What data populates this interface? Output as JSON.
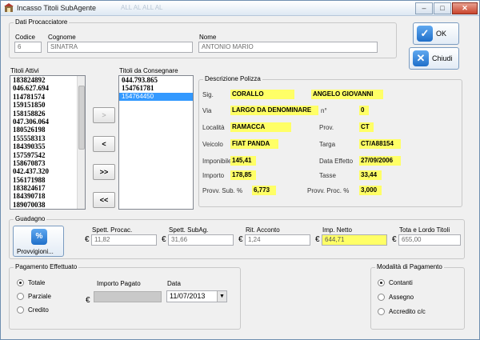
{
  "window": {
    "title": "Incasso Titoli SubAgente",
    "ghost_text": "ALL AL    ALL AL",
    "min_label": "–",
    "max_label": "□",
    "close_label": "✕"
  },
  "dati_procacciatore": {
    "group_label": "Dati Procacciatore",
    "codice_label": "Codice",
    "codice_value": "6",
    "cognome_label": "Cognome",
    "cognome_value": "SINATRA",
    "nome_label": "Nome",
    "nome_value": "ANTONIO MARIO"
  },
  "buttons": {
    "ok_label": "OK",
    "chiudi_label": "Chiudi",
    "move_right": ">",
    "move_left": "<",
    "move_all_right": ">>",
    "move_all_left": "<<"
  },
  "titoli_attivi": {
    "label": "Titoli Attivi",
    "items": [
      "183824892",
      "046.627.694",
      "114781574",
      "159151850",
      "158158826",
      "047.306.064",
      "180526198",
      "155558313",
      "184390355",
      "157597542",
      "158670873",
      "042.437.320",
      "156171988",
      "183824617",
      "184390718",
      "189070038"
    ]
  },
  "titoli_consegnare": {
    "label": "Titoli da Consegnare",
    "items": [
      "044.793.865",
      "154761781",
      "154764450"
    ],
    "selected_index": 2
  },
  "descrizione_polizza": {
    "group_label": "Descrizione Polizza",
    "sig_label": "Sig.",
    "sig_cognome": "CORALLO",
    "sig_nome": "ANGELO GIOVANNI",
    "via_label": "Via",
    "via_value": "LARGO DA DENOMINARE",
    "civico_label": "n°",
    "civico_value": "0",
    "localita_label": "Località",
    "localita_value": "RAMACCA",
    "prov_label": "Prov.",
    "prov_value": "CT",
    "veicolo_label": "Veicolo",
    "veicolo_value": "FIAT PANDA",
    "targa_label": "Targa",
    "targa_value": "CT/A88154",
    "imponibile_label": "Imponibile",
    "imponibile_value": "145,41",
    "data_effetto_label": "Data Effetto",
    "data_effetto_value": "27/09/2006",
    "importo_label": "Importo",
    "importo_value": "178,85",
    "tasse_label": "Tasse",
    "tasse_value": "33,44",
    "provv_sub_label": "Provv. Sub. %",
    "provv_sub_value": "6,773",
    "provv_proc_label": "Provv. Proc. %",
    "provv_proc_value": "3,000"
  },
  "guadagno": {
    "group_label": "Guadagno",
    "provvigioni_label": "Provvigioni...",
    "provvigioni_icon_text": "%",
    "euro": "€",
    "spett_procac_label": "Spett. Procac.",
    "spett_procac_value": "11,82",
    "spett_subag_label": "Spett. SubAg.",
    "spett_subag_value": "31,66",
    "rit_acconto_label": "Rit. Acconto",
    "rit_acconto_value": "1,24",
    "imp_netto_label": "Imp. Netto",
    "imp_netto_value": "644,71",
    "tot_lordo_label": "Tota e Lordo Titoli",
    "tot_lordo_value": "655,00"
  },
  "pagamento": {
    "group_label": "Pagamento Effettuato",
    "totale_label": "Totale",
    "parziale_label": "Parziale",
    "credito_label": "Credito",
    "importo_pagato_label": "Importo Pagato",
    "data_label": "Data",
    "data_value": "11/07/2013",
    "selected": "totale"
  },
  "modalita": {
    "group_label": "Modalità di Pagamento",
    "contanti_label": "Contanti",
    "assegno_label": "Assegno",
    "accredito_label": "Accredito c/c",
    "selected": "contanti"
  },
  "colors": {
    "highlight": "#ffff66",
    "selection": "#3399ff",
    "button_blue": "#1f6fc9"
  }
}
